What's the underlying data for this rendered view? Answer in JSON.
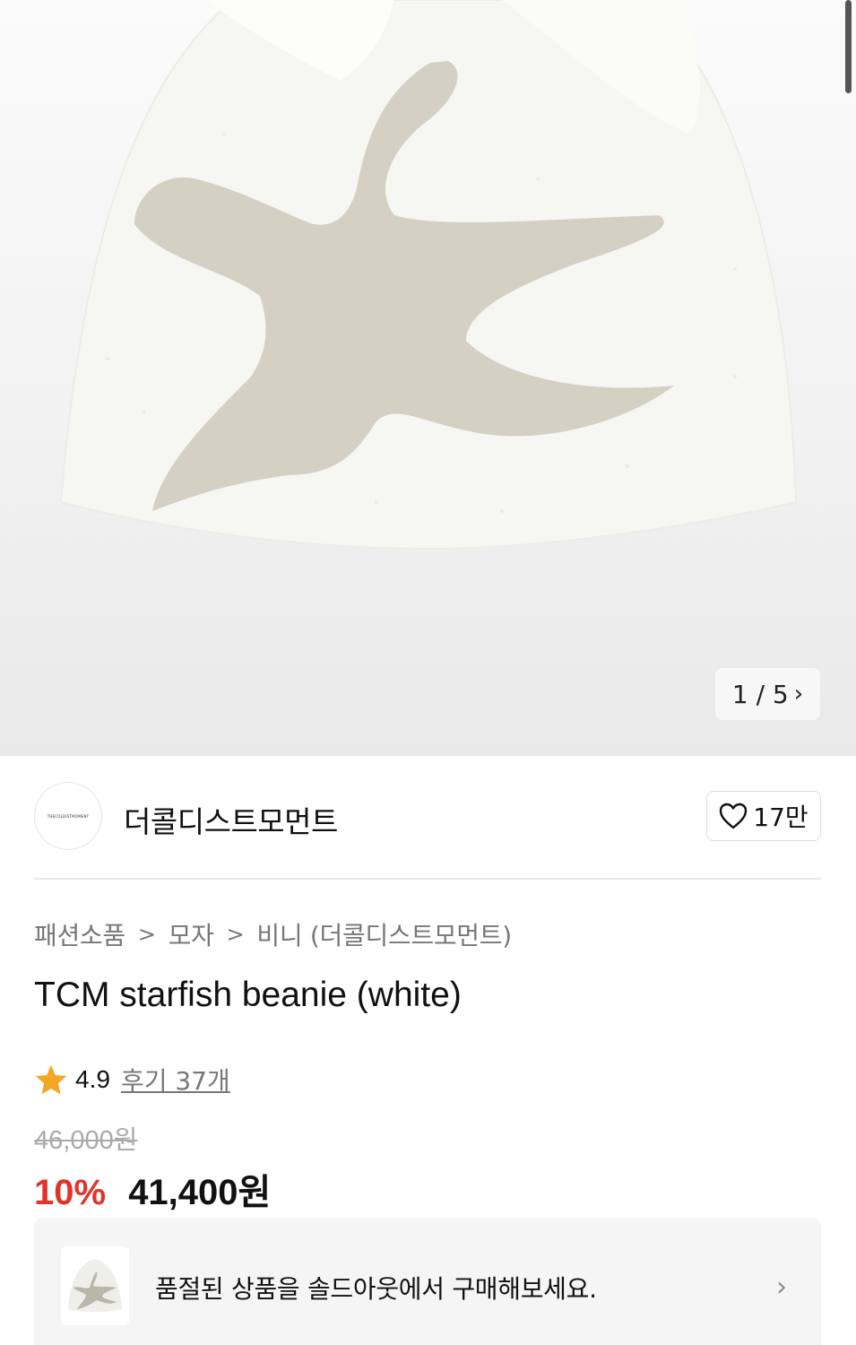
{
  "gallery": {
    "counter": "1 / 5",
    "next_icon": "chevron-right-icon"
  },
  "brand": {
    "logo_text": "THECOLDISTMOMENT",
    "name": "더콜디스트모먼트"
  },
  "like": {
    "count": "17만",
    "icon": "heart-outline-icon"
  },
  "breadcrumb": [
    "패션소품",
    "모자",
    "비니 (더콜디스트모먼트)"
  ],
  "product": {
    "title": "TCM starfish beanie (white)",
    "rating": "4.9",
    "reviews": "후기 37개",
    "original_price": "46,000원",
    "discount": "10%",
    "price": "41,400원"
  },
  "soldout": {
    "text": "품절된 상품을 솔드아웃에서 구매해보세요.",
    "chevron": "›"
  },
  "colors": {
    "discount": "#e0342a",
    "star": "#f5a623",
    "beanie": "#f6f6f3",
    "starfish": "#d4d0c3"
  }
}
